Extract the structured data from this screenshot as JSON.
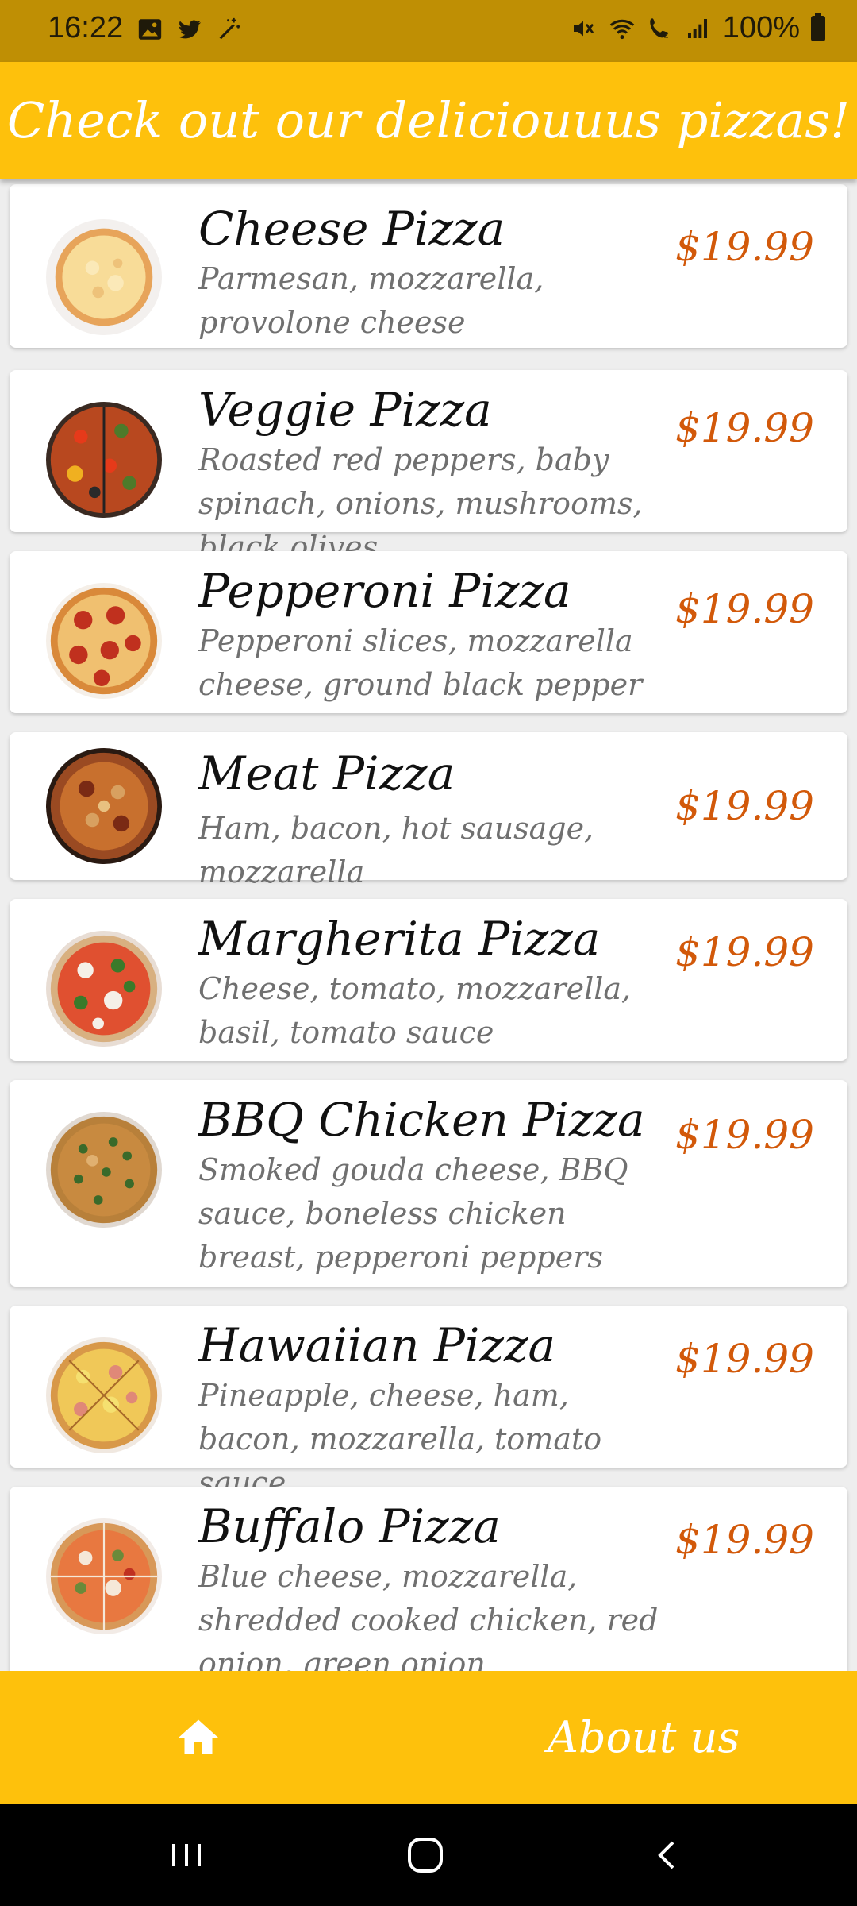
{
  "status_bar": {
    "time": "16:22",
    "battery": "100%",
    "left_icons": [
      "gallery-icon",
      "twitter-icon",
      "magic-wand-icon"
    ],
    "right_icons": [
      "mute-icon",
      "wifi-icon",
      "wifi-calling-icon",
      "signal-icon",
      "battery-icon"
    ]
  },
  "header": {
    "title": "Check out our deliciouuus pizzas!"
  },
  "pizzas": [
    {
      "name": "Cheese Pizza",
      "description": "Parmesan, mozzarella, provolone cheese",
      "price": "$19.99"
    },
    {
      "name": "Veggie Pizza",
      "description": "Roasted red peppers, baby spinach, onions, mushrooms, black olives",
      "price": "$19.99"
    },
    {
      "name": "Pepperoni Pizza",
      "description": "Pepperoni slices, mozzarella cheese, ground black pepper",
      "price": "$19.99"
    },
    {
      "name": "Meat Pizza",
      "description": "Ham, bacon, hot sausage, mozzarella",
      "price": "$19.99"
    },
    {
      "name": "Margherita Pizza",
      "description": "Cheese, tomato, mozzarella, basil, tomato sauce",
      "price": "$19.99"
    },
    {
      "name": "BBQ Chicken Pizza",
      "description": "Smoked gouda cheese, BBQ sauce, boneless chicken breast, pepperoni peppers",
      "price": "$19.99"
    },
    {
      "name": "Hawaiian Pizza",
      "description": "Pineapple, cheese, ham, bacon, mozzarella, tomato sauce",
      "price": "$19.99"
    },
    {
      "name": "Buffalo Pizza",
      "description": "Blue cheese, mozzarella, shredded cooked chicken, red onion, green onion",
      "price": "$19.99"
    }
  ],
  "bottom_nav": {
    "home_icon": "home-icon",
    "about_label": "About us"
  },
  "system_nav": {
    "icons": [
      "recents-icon",
      "home-circle-icon",
      "back-icon"
    ]
  },
  "colors": {
    "status_bar": "#bf8f04",
    "accent": "#fec10c",
    "price": "#d2590a"
  }
}
